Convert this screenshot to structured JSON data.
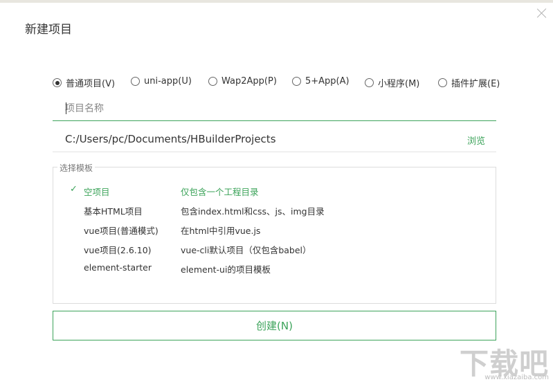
{
  "dialog": {
    "title": "新建项目"
  },
  "project_types": [
    {
      "label": "普通项目(V)",
      "checked": true
    },
    {
      "label": "uni-app(U)",
      "checked": false
    },
    {
      "label": "Wap2App(P)",
      "checked": false
    },
    {
      "label": "5+App(A)",
      "checked": false
    },
    {
      "label": "小程序(M)",
      "checked": false
    },
    {
      "label": "插件扩展(E)",
      "checked": false
    }
  ],
  "name_input": {
    "placeholder": "项目名称",
    "value": ""
  },
  "location": {
    "path": "C:/Users/pc/Documents/HBuilderProjects",
    "browse_label": "浏览"
  },
  "templates": {
    "legend": "选择模板",
    "check_mark": "✓",
    "items": [
      {
        "name": "空项目",
        "desc": "仅包含一个工程目录",
        "selected": true
      },
      {
        "name": "基本HTML项目",
        "desc": "包含index.html和css、js、img目录",
        "selected": false
      },
      {
        "name": "vue项目(普通模式)",
        "desc": "在html中引用vue.js",
        "selected": false
      },
      {
        "name": "vue项目(2.6.10)",
        "desc": "vue-cli默认项目（仅包含babel）",
        "selected": false
      },
      {
        "name": "element-starter",
        "desc": "element-ui的项目模板",
        "selected": false
      }
    ]
  },
  "create_button": {
    "label": "创建(N)"
  },
  "watermark": {
    "main": "下载吧",
    "sub": "www.xiazaiba.com"
  },
  "colors": {
    "accent": "#3ca35a",
    "text": "#333333",
    "border": "#dcdcdc"
  }
}
